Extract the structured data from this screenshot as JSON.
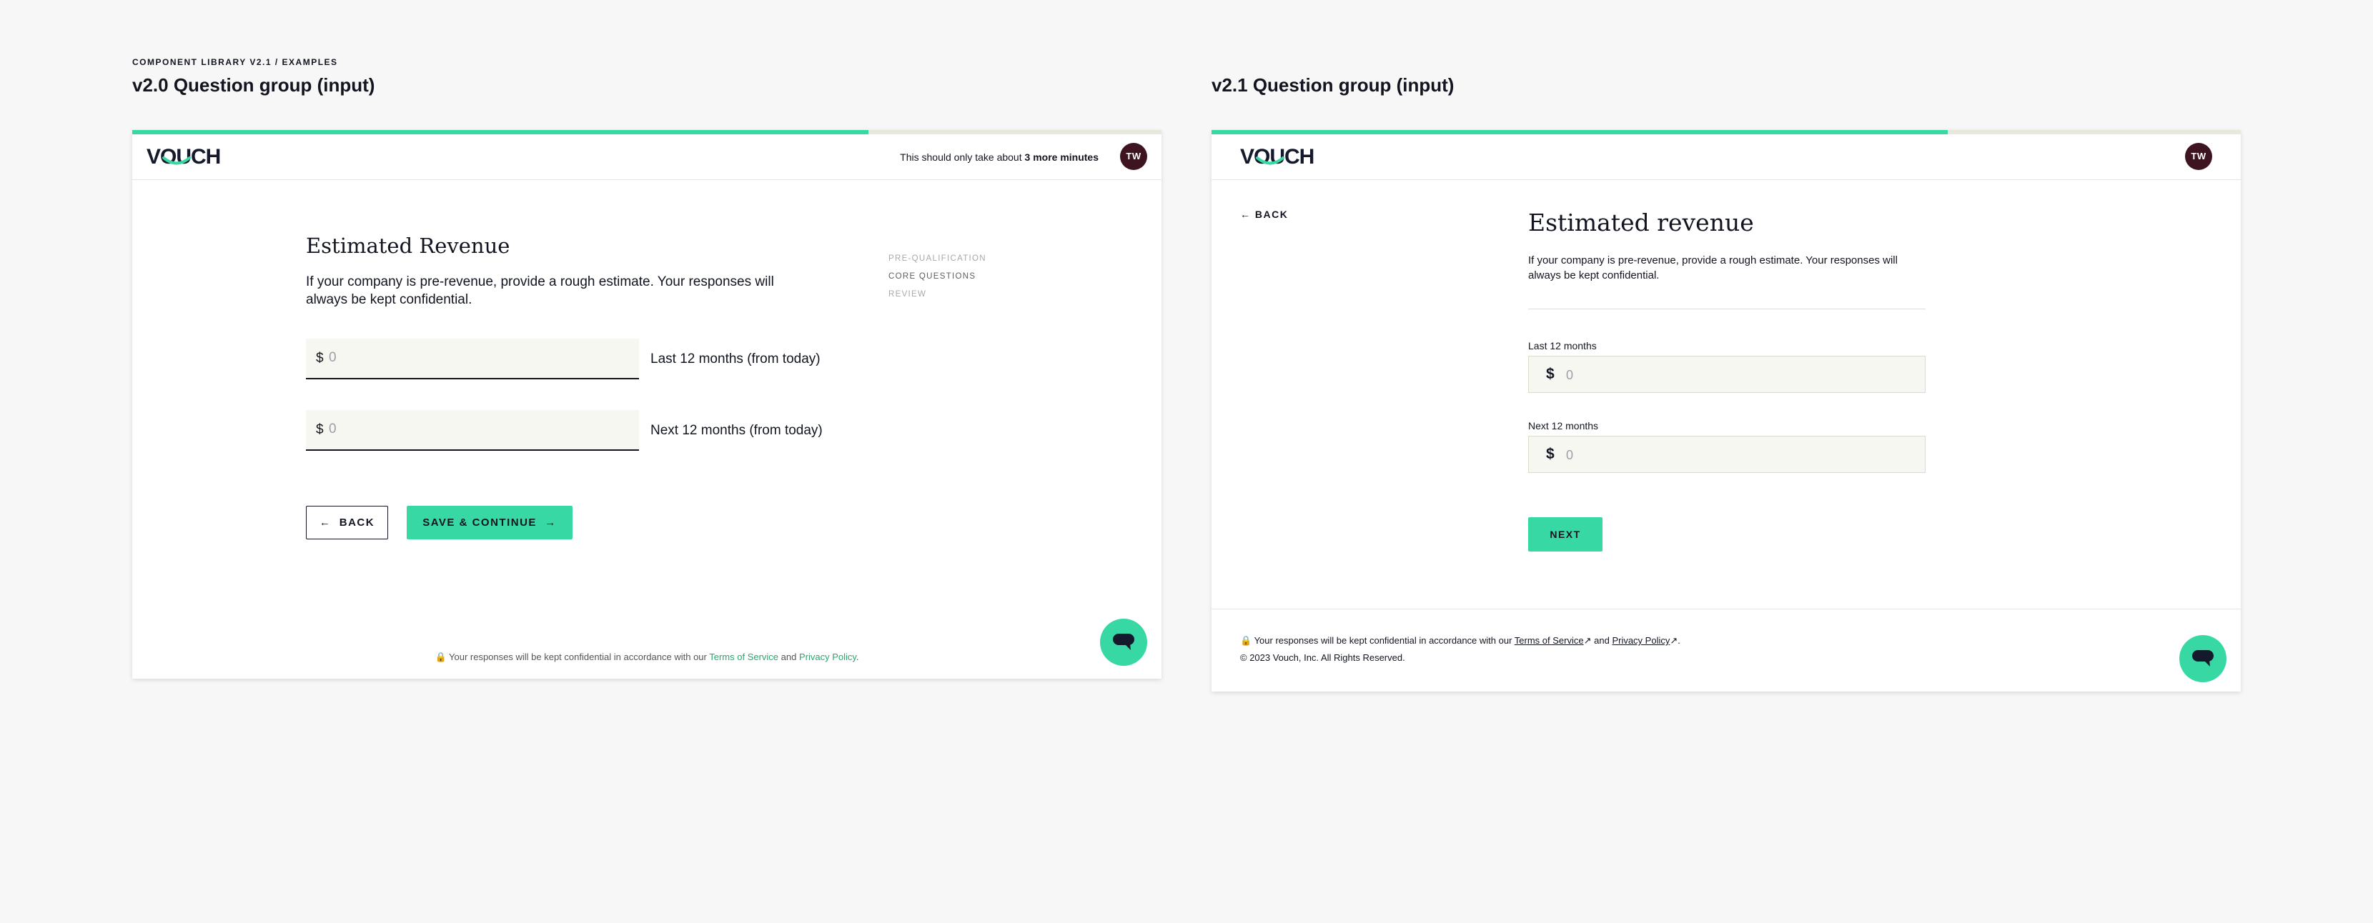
{
  "breadcrumb": "COMPONENT LIBRARY V2.1 / EXAMPLES",
  "colors": {
    "accent": "#38d8a4",
    "avatar_bg": "#3d1420",
    "text": "#12151f"
  },
  "v20": {
    "section_title": "v2.0 Question group (input)",
    "progress": 0.715,
    "logo": "VOUCH",
    "time_note_prefix": "This should only take about ",
    "time_note_bold": "3 more minutes",
    "avatar": "TW",
    "title": "Estimated Revenue",
    "description": "If your company is pre-revenue, provide a rough estimate. Your responses will always be kept confidential.",
    "steps": [
      "PRE-QUALIFICATION",
      "CORE QUESTIONS",
      "REVIEW"
    ],
    "fields": [
      {
        "currency": "$",
        "placeholder": "0",
        "label": "Last 12 months (from today)"
      },
      {
        "currency": "$",
        "placeholder": "0",
        "label": "Next 12 months (from today)"
      }
    ],
    "back_label": "BACK",
    "save_label": "SAVE & CONTINUE",
    "footer_text": "Your responses will be kept confidential in accordance with our ",
    "terms": "Terms of Service",
    "and": " and ",
    "privacy": "Privacy Policy",
    "period": "."
  },
  "v21": {
    "section_title": "v2.1 Question group (input)",
    "progress": 0.715,
    "logo": "VOUCH",
    "avatar": "TW",
    "back_label": "BACK",
    "title": "Estimated revenue",
    "description": "If your company is pre-revenue, provide a rough estimate. Your responses will always be kept confidential.",
    "fields": [
      {
        "label": "Last 12 months",
        "currency": "$",
        "placeholder": "0"
      },
      {
        "label": "Next 12 months",
        "currency": "$",
        "placeholder": "0"
      }
    ],
    "next_label": "NEXT",
    "footer_text": "Your responses will be kept confidential in accordance with our ",
    "terms": "Terms of Service",
    "and": " and ",
    "privacy": "Privacy Policy",
    "period": ".",
    "copyright": "© 2023 Vouch, Inc. All Rights Reserved."
  }
}
